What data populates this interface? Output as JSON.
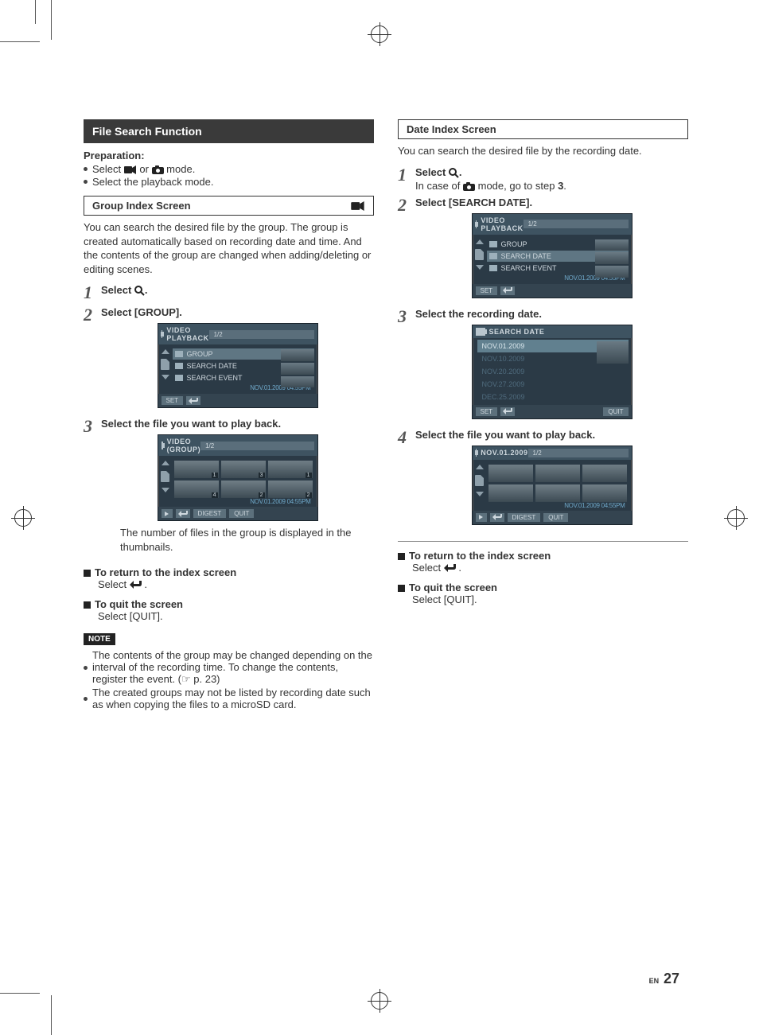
{
  "page": {
    "lang": "EN",
    "number": "27"
  },
  "left": {
    "title": "File Search Function",
    "preparation_label": "Preparation:",
    "prep_items": {
      "a_pre": "Select ",
      "a_mid": " or ",
      "a_post": " mode.",
      "b": "Select the playback mode."
    },
    "group_box": "Group Index Screen",
    "group_para": "You can search the desired file by the group. The group is created automatically based on recording date and time. And the contents of the group are changed when adding/deleting or editing scenes.",
    "steps": {
      "s1": "Select ",
      "s1_post": ".",
      "s2": "Select [GROUP].",
      "s3": "Select the file you want to play back."
    },
    "osd_menu": {
      "title": "VIDEO PLAYBACK",
      "page": "1/2",
      "items": [
        "GROUP",
        "SEARCH DATE",
        "SEARCH EVENT"
      ],
      "timestamp": "NOV.01.2009 04:55PM",
      "set": "SET"
    },
    "osd_group": {
      "title": "VIDEO (GROUP)",
      "page": "1/2",
      "counts": [
        "1",
        "3",
        "1",
        "4",
        "2",
        "2"
      ],
      "timestamp": "NOV.01.2009 04:55PM",
      "digest": "DIGEST",
      "quit": "QUIT"
    },
    "thumb_caption": "The number of files in the group is displayed in the thumbnails.",
    "return_h": "To return to the index screen",
    "return_b_pre": "Select ",
    "return_b_post": ".",
    "quit_h": "To quit the screen",
    "quit_b": "Select [QUIT].",
    "note_label": "NOTE",
    "notes": {
      "a": "The contents of the group may be changed depending on the interval of the recording time. To change the contents, register the event. (☞ p. 23)",
      "b": "The created groups may not be listed by recording date such as when copying the files to a microSD card."
    }
  },
  "right": {
    "date_box": "Date Index Screen",
    "date_para": "You can search the desired file by the recording date.",
    "steps": {
      "s1": "Select ",
      "s1_post": ".",
      "s1_sub_pre": "In case of ",
      "s1_sub_mid": " mode, go to step ",
      "s1_sub_step": "3",
      "s1_sub_post": ".",
      "s2": "Select [SEARCH DATE].",
      "s3": "Select the recording date.",
      "s4": "Select the file you want to play back."
    },
    "osd_menu": {
      "title": "VIDEO PLAYBACK",
      "page": "1/2",
      "items": [
        "GROUP",
        "SEARCH DATE",
        "SEARCH EVENT"
      ],
      "timestamp": "NOV.01.2009 04:55PM",
      "set": "SET"
    },
    "osd_dates": {
      "title": "SEARCH DATE",
      "rows": [
        "NOV.01.2009",
        "NOV.10.2009",
        "NOV.20.2009",
        "NOV.27.2009",
        "DEC.25.2009"
      ],
      "set": "SET",
      "quit": "QUIT"
    },
    "osd_day": {
      "title": "NOV.01.2009",
      "page": "1/2",
      "timestamp": "NOV.01.2009 04:55PM",
      "digest": "DIGEST",
      "quit": "QUIT"
    },
    "return_h": "To return to the index screen",
    "return_b_pre": "Select ",
    "return_b_post": ".",
    "quit_h": "To quit the screen",
    "quit_b": "Select [QUIT]."
  }
}
